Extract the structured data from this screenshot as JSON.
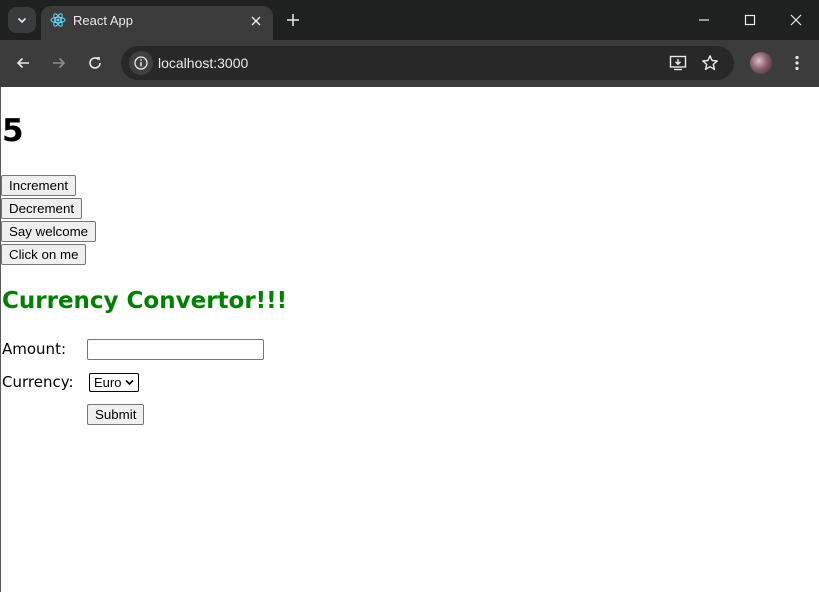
{
  "browser": {
    "tab_title": "React App",
    "url": "localhost:3000"
  },
  "icons": {
    "tab_search": "chevron-down-icon",
    "favicon": "react-logo-icon",
    "tab_close": "close-icon",
    "new_tab": "plus-icon",
    "minimize": "minimize-icon",
    "maximize": "maximize-icon",
    "close_window": "close-icon",
    "back": "arrow-left-icon",
    "forward": "arrow-right-icon",
    "reload": "reload-icon",
    "site_info": "info-icon",
    "install_app": "install-app-icon",
    "bookmark": "star-icon",
    "profile": "avatar",
    "menu": "kebab-menu-icon"
  },
  "colors": {
    "heading": "#008000",
    "tabstrip": "#1f2020",
    "toolbar": "#3c3c3c"
  },
  "app": {
    "counter": "5",
    "buttons": {
      "increment": "Increment",
      "decrement": "Decrement",
      "say_welcome": "Say welcome",
      "click_on_me": "Click on me"
    },
    "converter": {
      "heading": "Currency Convertor!!!",
      "amount_label": "Amount:",
      "amount_value": "",
      "currency_label": "Currency:",
      "currency_selected": "Euro",
      "submit_label": "Submit"
    }
  }
}
